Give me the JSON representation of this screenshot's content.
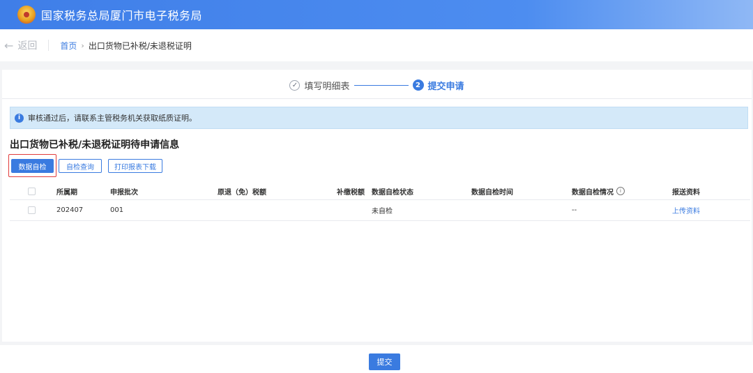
{
  "header": {
    "title": "国家税务总局厦门市电子税务局"
  },
  "breadcrumb": {
    "back": "返回",
    "home": "首页",
    "current": "出口货物已补税/未退税证明"
  },
  "steps": [
    {
      "index": "✓",
      "label": "填写明细表",
      "state": "done"
    },
    {
      "index": "2",
      "label": "提交申请",
      "state": "current"
    }
  ],
  "alert": {
    "icon": "i",
    "text": "审核通过后，请联系主管税务机关获取纸质证明。"
  },
  "section": {
    "title": "出口货物已补税/未退税证明待申请信息"
  },
  "toolbar": {
    "data_check": "数据自检",
    "check_query": "自检查询",
    "print_download": "打印报表下载"
  },
  "table": {
    "headers": [
      "所属期",
      "申报批次",
      "原退（免）税额",
      "补缴税额",
      "数据自检状态",
      "数据自检时间",
      "数据自检情况",
      "报送资料"
    ],
    "hint_icon": "i",
    "rows": [
      {
        "period": "202407",
        "batch": "001",
        "orig_refund": "",
        "paid_tax": "",
        "check_status": "未自检",
        "check_time": "",
        "check_result": "--",
        "upload": "上传资料"
      }
    ]
  },
  "footer": {
    "submit": "提交"
  },
  "colors": {
    "primary": "#3a7be0",
    "alert_bg": "#d4e9f9",
    "highlight": "#e03b3b"
  }
}
